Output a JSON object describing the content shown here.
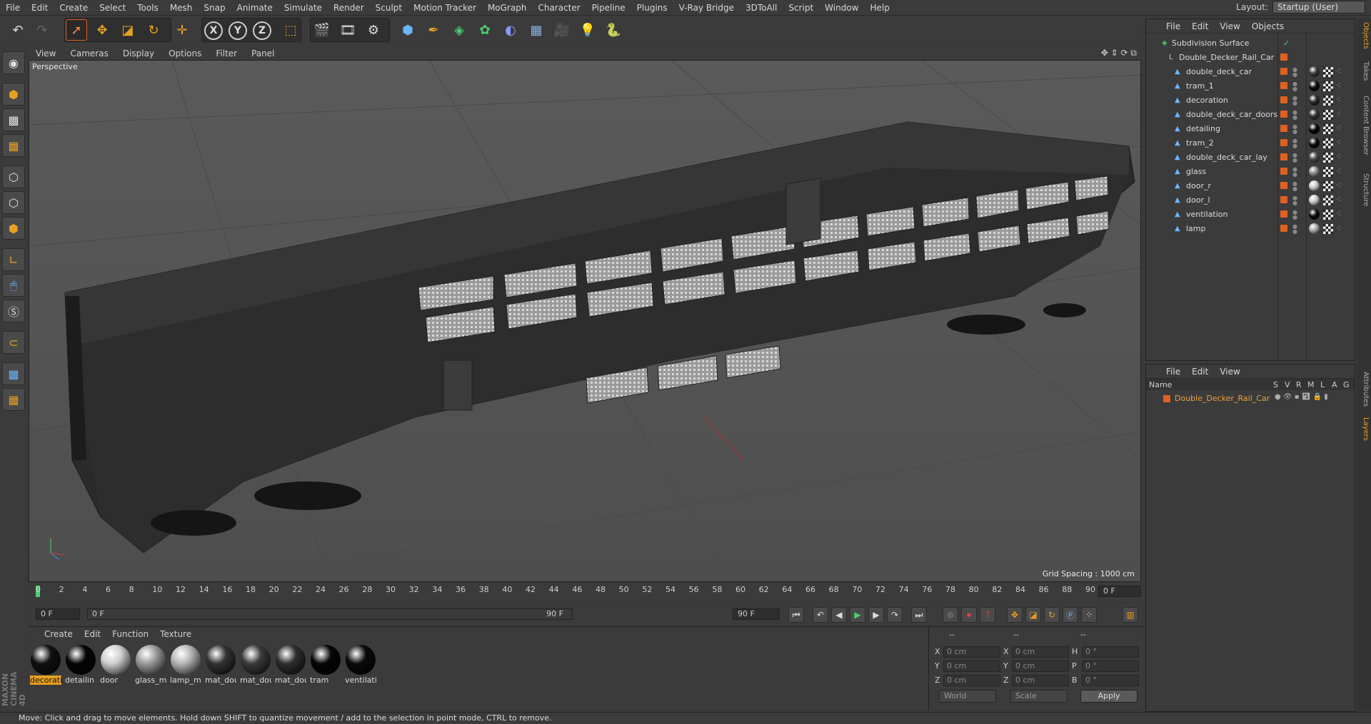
{
  "menubar": {
    "items": [
      "File",
      "Edit",
      "Create",
      "Select",
      "Tools",
      "Mesh",
      "Snap",
      "Animate",
      "Simulate",
      "Render",
      "Sculpt",
      "Motion Tracker",
      "MoGraph",
      "Character",
      "Pipeline",
      "Plugins",
      "V-Ray Bridge",
      "3DToAll",
      "Script",
      "Window",
      "Help"
    ],
    "layout_label": "Layout:",
    "layout_value": "Startup (User)"
  },
  "toolbar": {
    "axis_x": "X",
    "axis_y": "Y",
    "axis_z": "Z"
  },
  "viewport": {
    "menu": [
      "View",
      "Cameras",
      "Display",
      "Options",
      "Filter",
      "Panel"
    ],
    "label": "Perspective",
    "grid_spacing": "Grid Spacing : 1000 cm"
  },
  "timeline": {
    "ticks": [
      "0",
      "2",
      "4",
      "6",
      "8",
      "10",
      "12",
      "14",
      "16",
      "18",
      "20",
      "22",
      "24",
      "26",
      "28",
      "30",
      "32",
      "34",
      "36",
      "38",
      "40",
      "42",
      "44",
      "46",
      "48",
      "50",
      "52",
      "54",
      "56",
      "58",
      "60",
      "62",
      "64",
      "66",
      "68",
      "70",
      "72",
      "74",
      "76",
      "78",
      "80",
      "82",
      "84",
      "86",
      "88",
      "90"
    ],
    "current_frame": "0 F"
  },
  "transport": {
    "start": "0 F",
    "range_start": "0 F",
    "range_end": "90 F",
    "end": "90 F"
  },
  "materials": {
    "menu": [
      "Create",
      "Edit",
      "Function",
      "Texture"
    ],
    "items": [
      {
        "label": "decorati",
        "color": "#111111",
        "selected": true
      },
      {
        "label": "detailin",
        "color": "#050505"
      },
      {
        "label": "door",
        "color": "#cfcfcf"
      },
      {
        "label": "glass_m",
        "color": "#9a9a9a"
      },
      {
        "label": "lamp_m",
        "color": "#b5b5b5"
      },
      {
        "label": "mat_dou",
        "color": "#333333"
      },
      {
        "label": "mat_dou",
        "color": "#3a3a3a"
      },
      {
        "label": "mat_dou",
        "color": "#2e2e2e"
      },
      {
        "label": "tram",
        "color": "#060606"
      },
      {
        "label": "ventilati",
        "color": "#0a0a0a"
      }
    ]
  },
  "coords": {
    "header": [
      "--",
      "--",
      "--"
    ],
    "rows": [
      {
        "a": "X",
        "av": "0 cm",
        "b": "X",
        "bv": "0 cm",
        "c": "H",
        "cv": "0 °"
      },
      {
        "a": "Y",
        "av": "0 cm",
        "b": "Y",
        "bv": "0 cm",
        "c": "P",
        "cv": "0 °"
      },
      {
        "a": "Z",
        "av": "0 cm",
        "b": "Z",
        "bv": "0 cm",
        "c": "B",
        "cv": "0 °"
      }
    ],
    "world": "World",
    "scale": "Scale",
    "apply": "Apply"
  },
  "objects": {
    "menu": [
      "File",
      "Edit",
      "View",
      "Objects"
    ],
    "root": "Subdivision Surface",
    "group": "Double_Decker_Rail_Car",
    "children": [
      {
        "name": "double_deck_car",
        "tag": "#3a3a3a"
      },
      {
        "name": "tram_1",
        "tag": "#0a0a0a"
      },
      {
        "name": "decoration",
        "tag": "#2a2a2a"
      },
      {
        "name": "double_deck_car_doors",
        "tag": "#333333"
      },
      {
        "name": "detailing",
        "tag": "#050505"
      },
      {
        "name": "tram_2",
        "tag": "#0a0a0a"
      },
      {
        "name": "double_deck_car_lay",
        "tag": "#4a4a4a"
      },
      {
        "name": "glass",
        "tag": "#8a8a8a"
      },
      {
        "name": "door_r",
        "tag": "#c8c8c8"
      },
      {
        "name": "door_l",
        "tag": "#c8c8c8"
      },
      {
        "name": "ventilation",
        "tag": "#0a0a0a"
      },
      {
        "name": "lamp",
        "tag": "#a8a8a8"
      }
    ]
  },
  "layers": {
    "menu": [
      "File",
      "Edit",
      "View"
    ],
    "headers": [
      "Name",
      "S",
      "V",
      "R",
      "M",
      "L",
      "A",
      "G"
    ],
    "row": "Double_Decker_Rail_Car"
  },
  "right_tabs": [
    "Objects",
    "Takes",
    "Content Browser",
    "Structure"
  ],
  "right_tabs2": [
    "Attributes",
    "Layers"
  ],
  "status": "Move: Click and drag to move elements. Hold down SHIFT to quantize movement / add to the selection in point mode, CTRL to remove.",
  "brand": "MAXON CINEMA 4D"
}
